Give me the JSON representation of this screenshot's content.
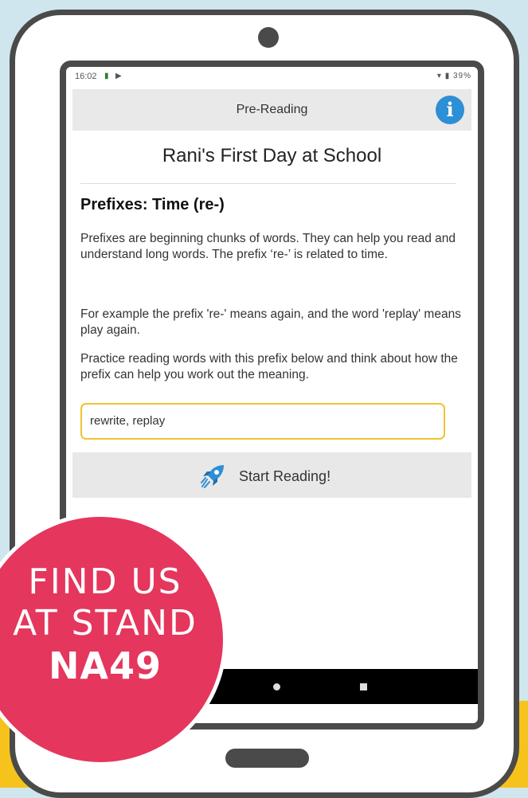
{
  "status_bar": {
    "time": "16:02",
    "battery": "39%"
  },
  "app_bar": {
    "title": "Pre-Reading",
    "info_icon": "info-icon"
  },
  "story": {
    "title": "Rani's First Day at School"
  },
  "lesson": {
    "heading": "Prefixes: Time (re-)",
    "paragraph_1": "Prefixes are beginning chunks of words. They can help you read and understand long words. The prefix ‘re-’ is related to time.",
    "paragraph_2": "For example the prefix 're-' means again, and the word 'replay' means play again.",
    "paragraph_3": "Practice reading words with this prefix below and think about how the prefix can help you work out the meaning.",
    "words": "rewrite, replay"
  },
  "start_button": {
    "label": "Start Reading!",
    "icon": "rocket-icon"
  },
  "promo_badge": {
    "line_1": "FIND US",
    "line_2": "AT STAND",
    "line_3": "NA49"
  },
  "colors": {
    "accent": "#2d8fd6",
    "input_border": "#f1c232",
    "badge": "#e5365d",
    "frame": "#4a4a4a"
  }
}
